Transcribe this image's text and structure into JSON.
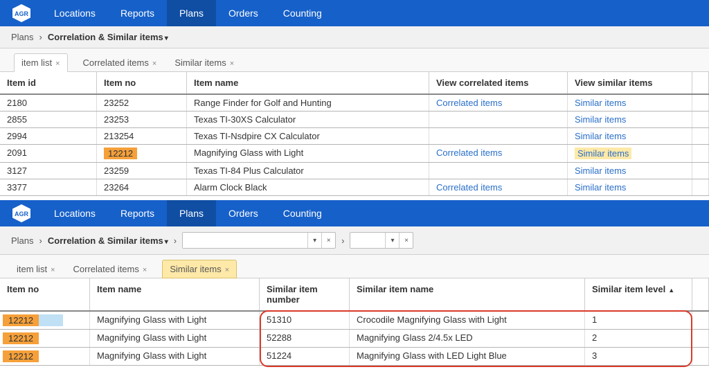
{
  "logo_text": "AGR",
  "nav": [
    "Locations",
    "Reports",
    "Plans",
    "Orders",
    "Counting"
  ],
  "crumb_root": "Plans",
  "crumb_page": "Correlation & Similar items",
  "tabs": {
    "item_list": "item list",
    "correlated": "Correlated items",
    "similar": "Similar items"
  },
  "top": {
    "headers": {
      "item_id": "Item id",
      "item_no": "Item no",
      "item_name": "Item name",
      "view_corr": "View correlated items",
      "view_sim": "View similar items"
    },
    "link_corr": "Correlated items",
    "link_sim": "Similar items",
    "rows": [
      {
        "id": "2180",
        "no": "23252",
        "name": "Range Finder for Golf and Hunting",
        "corr": true,
        "sim": true
      },
      {
        "id": "2855",
        "no": "23253",
        "name": "Texas TI-30XS Calculator",
        "corr": false,
        "sim": true
      },
      {
        "id": "2994",
        "no": "213254",
        "name": "Texas TI-Nsdpire CX Calculator",
        "corr": false,
        "sim": true
      },
      {
        "id": "2091",
        "no": "12212",
        "name": "Magnifying Glass with Light",
        "corr": true,
        "sim": true,
        "hl": true
      },
      {
        "id": "3127",
        "no": "23259",
        "name": "Texas TI-84 Plus Calculator",
        "corr": false,
        "sim": true
      },
      {
        "id": "3377",
        "no": "23264",
        "name": "Alarm Clock Black",
        "corr": true,
        "sim": true
      }
    ]
  },
  "bottom": {
    "headers": {
      "item_no": "Item no",
      "item_name": "Item name",
      "sim_no": "Similar item number",
      "sim_name": "Similar item name",
      "sim_level": "Similar item level"
    },
    "rows": [
      {
        "no": "12212",
        "name": "Magnifying Glass with Light",
        "sno": "51310",
        "sname": "Crocodile Magnifying Glass with Light",
        "lvl": "1",
        "blue": true
      },
      {
        "no": "12212",
        "name": "Magnifying Glass with Light",
        "sno": "52288",
        "sname": "Magnifying Glass 2/4.5x LED",
        "lvl": "2",
        "blue": false
      },
      {
        "no": "12212",
        "name": "Magnifying Glass with Light",
        "sno": "51224",
        "sname": "Magnifying Glass with LED Light Blue",
        "lvl": "3",
        "blue": false
      }
    ]
  }
}
